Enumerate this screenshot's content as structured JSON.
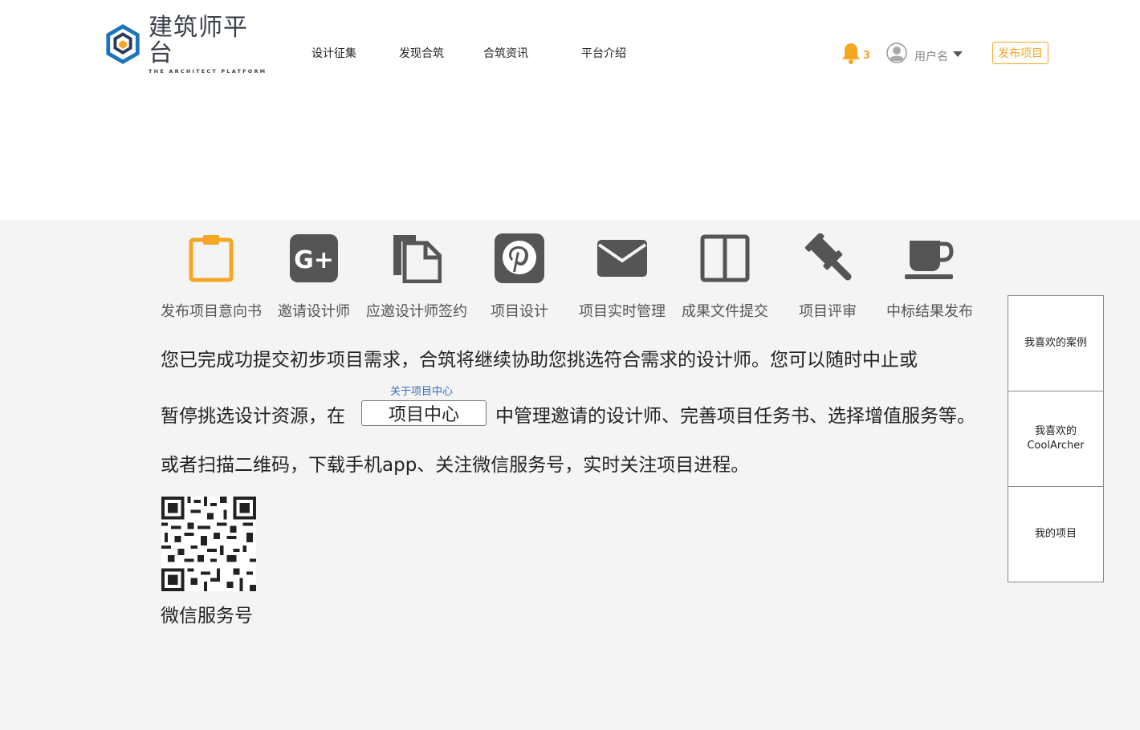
{
  "brand": {
    "name_cn": "建筑师平台",
    "name_en": "THE ARCHITECT PLATFORM"
  },
  "nav": [
    {
      "label": "设计征集"
    },
    {
      "label": "发现合筑"
    },
    {
      "label": "合筑资讯"
    },
    {
      "label": "平台介绍"
    }
  ],
  "user": {
    "notification_count": "3",
    "username": "用户名",
    "publish_label": "发布项目"
  },
  "steps": [
    {
      "label": "发布项目意向书",
      "icon": "clipboard-icon",
      "active": true
    },
    {
      "label": "邀请设计师",
      "icon": "google-plus-icon",
      "active": false
    },
    {
      "label": "应邀设计师签约",
      "icon": "documents-icon",
      "active": false
    },
    {
      "label": "项目设计",
      "icon": "pinterest-icon",
      "active": false
    },
    {
      "label": "项目实时管理",
      "icon": "envelope-icon",
      "active": false
    },
    {
      "label": "成果文件提交",
      "icon": "columns-icon",
      "active": false
    },
    {
      "label": "项目评审",
      "icon": "gavel-icon",
      "active": false
    },
    {
      "label": "中标结果发布",
      "icon": "coffee-cup-icon",
      "active": false
    }
  ],
  "message": {
    "line1": "您已完成功提交初步项目需求，合筑将继续协助您挑选符合需求的设计师。您可以随时中止或",
    "line2_before": "暂停挑选设计资源，在",
    "center_button": "项目中心",
    "center_hint": "关于项目中心",
    "line2_after": "中管理邀请的设计师、完善项目任务书、选择增值服务等。",
    "line3": "或者扫描二维码，下载手机app、关注微信服务号，实时关注项目进程。"
  },
  "qr": {
    "label": "微信服务号"
  },
  "side_panel": [
    {
      "label": "我喜欢的案例"
    },
    {
      "label": "我喜欢的CoolArcher"
    },
    {
      "label": "我的项目"
    }
  ],
  "colors": {
    "accent": "#f5a623",
    "icon_gray": "#555555",
    "link_blue": "#3b6cc4",
    "main_bg": "#f4f4f4"
  }
}
